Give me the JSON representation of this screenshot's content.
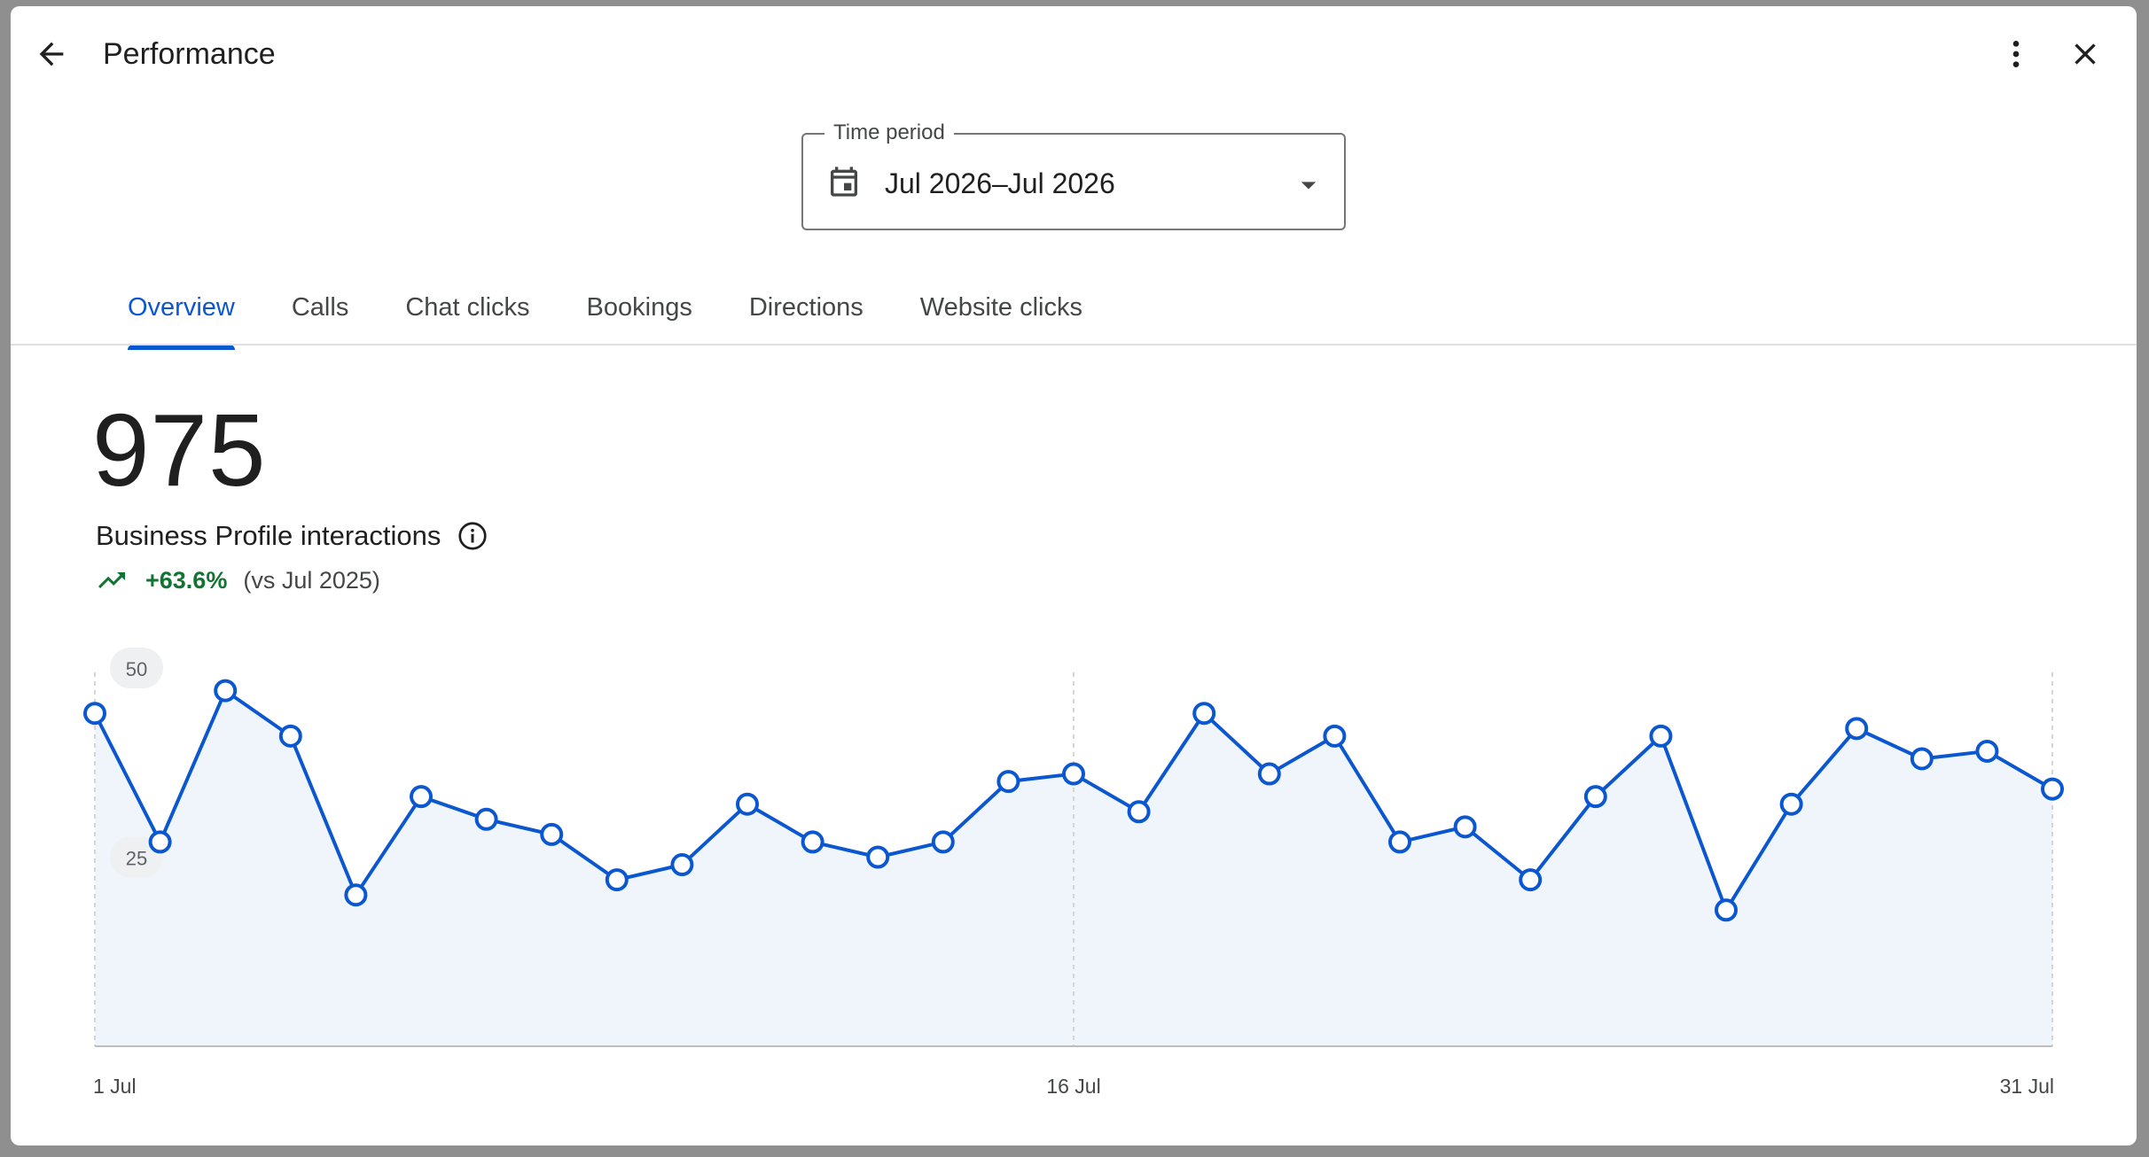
{
  "header": {
    "title": "Performance",
    "back_icon": "arrow-back-icon",
    "more_icon": "more-vert-icon",
    "close_icon": "close-icon"
  },
  "time_period": {
    "label": "Time period",
    "value": "Jul 2026–Jul 2026"
  },
  "tabs": [
    {
      "label": "Overview",
      "active": true
    },
    {
      "label": "Calls",
      "active": false
    },
    {
      "label": "Chat clicks",
      "active": false
    },
    {
      "label": "Bookings",
      "active": false
    },
    {
      "label": "Directions",
      "active": false
    },
    {
      "label": "Website clicks",
      "active": false
    }
  ],
  "summary": {
    "total": "975",
    "metric_label": "Business Profile interactions",
    "change": "+63.6%",
    "comparison": "(vs Jul 2025)"
  },
  "colors": {
    "accent": "#0b57d0",
    "positive": "#137333",
    "area_fill": "#f0f5fc"
  },
  "chart_data": {
    "type": "line",
    "x": [
      1,
      2,
      3,
      4,
      5,
      6,
      7,
      8,
      9,
      10,
      11,
      12,
      13,
      14,
      15,
      16,
      17,
      18,
      19,
      20,
      21,
      22,
      23,
      24,
      25,
      26,
      27,
      28,
      29,
      30,
      31
    ],
    "series": [
      {
        "values": [
          44,
          27,
          47,
          41,
          20,
          33,
          30,
          28,
          22,
          24,
          32,
          27,
          25,
          27,
          35,
          36,
          31,
          44,
          36,
          41,
          27,
          29,
          22,
          33,
          41,
          18,
          32,
          42,
          38,
          39,
          34
        ]
      }
    ],
    "ytick_labels": [
      "50",
      "25"
    ],
    "yticks": [
      50,
      25
    ],
    "xtick_labels": [
      "1 Jul",
      "16 Jul",
      "31 Jul"
    ],
    "xticks": [
      1,
      16,
      31
    ],
    "ylim": [
      0,
      50
    ],
    "grid": "vertical dashed at ticks"
  }
}
